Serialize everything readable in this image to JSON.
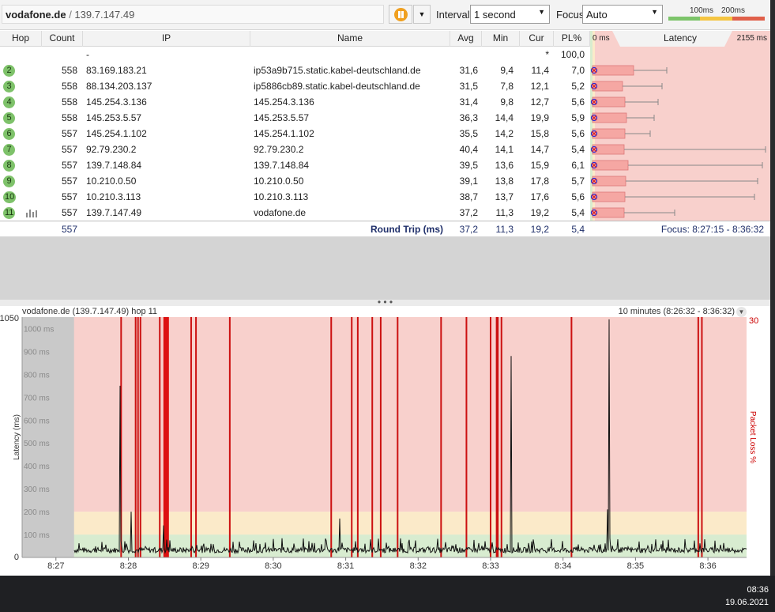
{
  "toolbar": {
    "target_host": "vodafone.de",
    "target_sep": " / ",
    "target_ip": "139.7.147.49",
    "interval_label": "Interval",
    "interval_value": "1 second",
    "focus_label": "Focus",
    "focus_value": "Auto",
    "legend_100": "100ms",
    "legend_200": "200ms",
    "colors": {
      "good": "#7cc46a",
      "warn": "#f5c542",
      "bad": "#e0604a"
    }
  },
  "table": {
    "headers": {
      "hop": "Hop",
      "count": "Count",
      "ip": "IP",
      "name": "Name",
      "avg": "Avg",
      "min": "Min",
      "cur": "Cur",
      "pl": "PL%",
      "lat_min": "0 ms",
      "latency": "Latency",
      "lat_max": "2155 ms"
    },
    "rows": [
      {
        "hop": "",
        "count": "",
        "ip": "-",
        "name": "",
        "avg": "",
        "min": "",
        "cur": "*",
        "pl": "100,0"
      },
      {
        "hop": "2",
        "count": "558",
        "ip": "83.169.183.21",
        "name": "ip53a9b715.static.kabel-deutschland.de",
        "avg": "31,6",
        "min": "9,4",
        "cur": "11,4",
        "pl": "7,0"
      },
      {
        "hop": "3",
        "count": "558",
        "ip": "88.134.203.137",
        "name": "ip5886cb89.static.kabel-deutschland.de",
        "avg": "31,5",
        "min": "7,8",
        "cur": "12,1",
        "pl": "5,2"
      },
      {
        "hop": "4",
        "count": "558",
        "ip": "145.254.3.136",
        "name": "145.254.3.136",
        "avg": "31,4",
        "min": "9,8",
        "cur": "12,7",
        "pl": "5,6"
      },
      {
        "hop": "5",
        "count": "558",
        "ip": "145.253.5.57",
        "name": "145.253.5.57",
        "avg": "36,3",
        "min": "14,4",
        "cur": "19,9",
        "pl": "5,9"
      },
      {
        "hop": "6",
        "count": "557",
        "ip": "145.254.1.102",
        "name": "145.254.1.102",
        "avg": "35,5",
        "min": "14,2",
        "cur": "15,8",
        "pl": "5,6"
      },
      {
        "hop": "7",
        "count": "557",
        "ip": "92.79.230.2",
        "name": "92.79.230.2",
        "avg": "40,4",
        "min": "14,1",
        "cur": "14,7",
        "pl": "5,4"
      },
      {
        "hop": "8",
        "count": "557",
        "ip": "139.7.148.84",
        "name": "139.7.148.84",
        "avg": "39,5",
        "min": "13,6",
        "cur": "15,9",
        "pl": "6,1"
      },
      {
        "hop": "9",
        "count": "557",
        "ip": "10.210.0.50",
        "name": "10.210.0.50",
        "avg": "39,1",
        "min": "13,8",
        "cur": "17,8",
        "pl": "5,7"
      },
      {
        "hop": "10",
        "count": "557",
        "ip": "10.210.3.113",
        "name": "10.210.3.113",
        "avg": "38,7",
        "min": "13,7",
        "cur": "17,6",
        "pl": "5,6"
      },
      {
        "hop": "11",
        "count": "557",
        "ip": "139.7.147.49",
        "name": "vodafone.de",
        "avg": "37,2",
        "min": "11,3",
        "cur": "19,2",
        "pl": "5,4"
      }
    ],
    "summary": {
      "count": "557",
      "label": "Round Trip (ms)",
      "avg": "37,2",
      "min": "11,3",
      "cur": "19,2",
      "pl": "5,4",
      "focus": "Focus: 8:27:15 - 8:36:32"
    }
  },
  "graph": {
    "title": "vodafone.de (139.7.147.49) hop 11",
    "range_label": "10 minutes (8:26:32 - 8:36:32)",
    "y_top": "1050",
    "y_zero": "0",
    "y_ticks": [
      "1000 ms",
      "900 ms",
      "800 ms",
      "700 ms",
      "600 ms",
      "500 ms",
      "400 ms",
      "300 ms",
      "200 ms",
      "100 ms"
    ],
    "right_top": "30",
    "left_axis_label": "Latency (ms)",
    "right_axis_label": "Packet Loss %",
    "x_ticks": [
      "8:27",
      "8:28",
      "8:29",
      "8:30",
      "8:31",
      "8:32",
      "8:33",
      "8:34",
      "8:35",
      "8:36"
    ]
  },
  "chart_data": {
    "type": "line",
    "title": "vodafone.de (139.7.147.49) hop 11",
    "xlabel": "",
    "ylabel": "Latency (ms)",
    "ylim": [
      0,
      1050
    ],
    "y2label": "Packet Loss %",
    "y2lim": [
      0,
      30
    ],
    "x_range": [
      "8:26:32",
      "8:36:32"
    ],
    "bands": [
      {
        "from": 0,
        "to": 100,
        "color": "#d8ecd0"
      },
      {
        "from": 100,
        "to": 200,
        "color": "#fbeac9"
      },
      {
        "from": 200,
        "to": 1050,
        "color": "#f8d0cc"
      }
    ],
    "latency_spikes": [
      {
        "t": "8:27:53",
        "ms": 750
      },
      {
        "t": "8:28:02",
        "ms": 200
      },
      {
        "t": "8:28:29",
        "ms": 140
      },
      {
        "t": "8:30:55",
        "ms": 170
      },
      {
        "t": "8:33:17",
        "ms": 880
      },
      {
        "t": "8:34:38",
        "ms": 1040
      },
      {
        "t": "8:34:37",
        "ms": 210
      }
    ],
    "loss_markers": [
      "8:27:54",
      "8:28:06",
      "8:28:08",
      "8:28:10",
      "8:28:26",
      "8:28:31",
      "8:28:52",
      "8:28:56",
      "8:29:24",
      "8:30:48",
      "8:31:05",
      "8:31:10",
      "8:31:22",
      "8:31:29",
      "8:31:43",
      "8:32:19",
      "8:32:40",
      "8:33:00",
      "8:33:05",
      "8:33:06",
      "8:33:09",
      "8:34:07",
      "8:35:52",
      "8:35:55"
    ],
    "baseline_ms": [
      20,
      60
    ]
  },
  "taskbar": {
    "time": "08:36",
    "date": "19.06.2021"
  }
}
